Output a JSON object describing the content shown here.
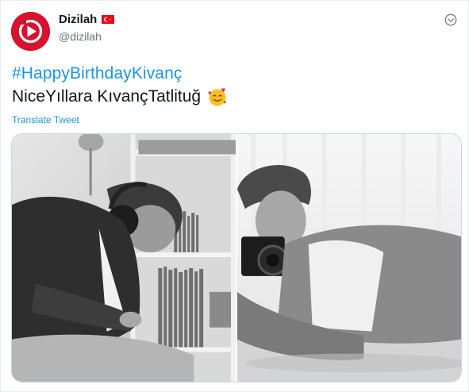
{
  "account": {
    "display_name": "Dizilah",
    "handle": "@dizilah",
    "avatar_icon": "play-logo-icon",
    "flag_icon": "turkey-flag-icon",
    "brand_color": "#d6122e"
  },
  "tweet": {
    "hashtag": "#HappyBirthdayKivanç",
    "text": "NiceYıllara KıvançTatlituğ",
    "emoji_icon": "smiling-face-with-hearts-icon",
    "translate_label": "Translate Tweet",
    "link_color": "#1b95e0"
  },
  "media": {
    "photos": [
      {
        "icon": "photo-man-with-headphones-records"
      },
      {
        "icon": "photo-man-lying-with-camera"
      }
    ]
  }
}
